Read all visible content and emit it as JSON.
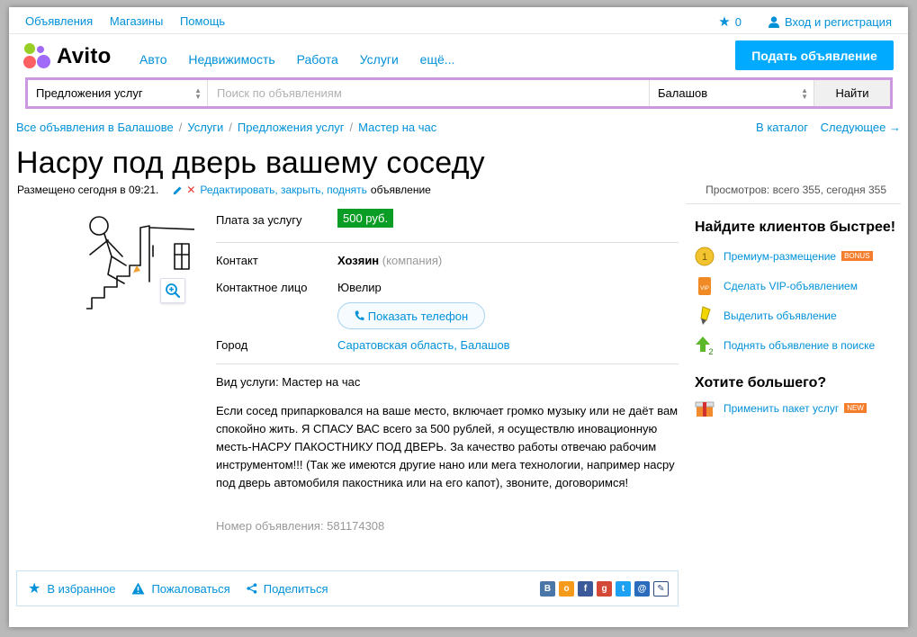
{
  "topbar": {
    "links": [
      "Объявления",
      "Магазины",
      "Помощь"
    ],
    "favorites_count": "0",
    "login": "Вход и регистрация"
  },
  "header": {
    "logo": "Avito",
    "nav": [
      "Авто",
      "Недвижимость",
      "Работа",
      "Услуги",
      "ещё..."
    ],
    "post_button": "Подать объявление"
  },
  "search": {
    "category": "Предложения услуг",
    "placeholder": "Поиск по объявлениям",
    "city": "Балашов",
    "submit": "Найти"
  },
  "breadcrumbs": [
    "Все объявления в Балашове",
    "Услуги",
    "Предложения услуг",
    "Мастер на час"
  ],
  "breadcrumbs_right": {
    "catalog": "В каталог",
    "next": "Следующее →"
  },
  "listing": {
    "title": "Насру под дверь вашему соседу",
    "posted": "Размещено сегодня в 09:21.",
    "edit_links": "Редактировать, закрыть, поднять",
    "edit_suffix": "объявление",
    "views": "Просмотров: всего 355, сегодня 355",
    "params": {
      "price_label": "Плата за услугу",
      "price": "500 руб.",
      "contact_label": "Контакт",
      "contact_name": "Хозяин",
      "contact_type": "(компания)",
      "person_label": "Контактное лицо",
      "person": "Ювелир",
      "phone_button": "Показать телефон",
      "city_label": "Город",
      "city": "Саратовская область, Балашов"
    },
    "service_type": "Вид услуги: Мастер на час",
    "description": "Если сосед припарковался на ваше место, включает громко музыку или не даёт вам спокойно жить. Я СПАСУ ВАС всего за 500 рублей, я осуществлю иновационную месть-НАСРУ ПАКОСТНИКУ ПОД ДВЕРЬ. За качество работы отвечаю рабочим инструментом!!! (Так же имеются другие нано или мега технологии, например насру под дверь автомобиля пакостника или на его капот), звоните, договоримся!",
    "ad_number": "Номер объявления: 581174308"
  },
  "actions": {
    "favorite": "В избранное",
    "report": "Пожаловаться",
    "share": "Поделиться"
  },
  "sidebar": {
    "heading1": "Найдите клиентов быстрее!",
    "items": [
      {
        "label": "Премиум-размещение",
        "badge": "BONUS"
      },
      {
        "label": "Сделать VIP-объявлением"
      },
      {
        "label": "Выделить объявление"
      },
      {
        "label": "Поднять объявление в поиске"
      }
    ],
    "heading2": "Хотите большего?",
    "package": {
      "label": "Применить пакет услуг",
      "badge": "NEW"
    }
  },
  "colors": {
    "link": "#0091d9",
    "post_button": "#00aaff",
    "price_bg": "#0a9d25",
    "search_border": "#cc99e0",
    "badge": "#f47e2b"
  }
}
